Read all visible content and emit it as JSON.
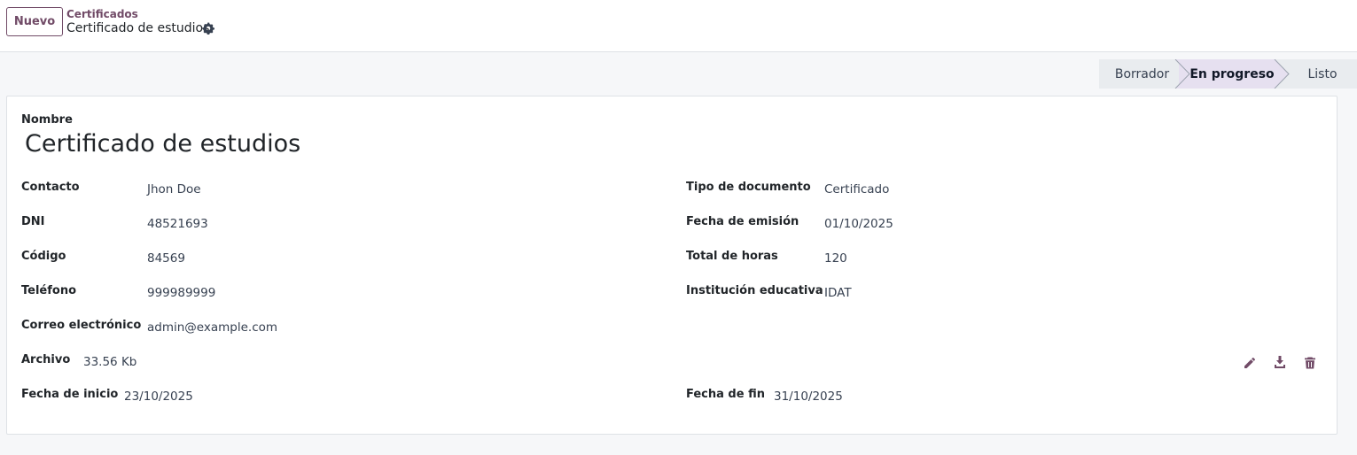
{
  "header": {
    "new_button": "Nuevo",
    "breadcrumb_parent": "Certificados",
    "breadcrumb_current": "Certificado de estudios"
  },
  "status": {
    "stages": [
      "Borrador",
      "En progreso",
      "Listo"
    ],
    "active": "En progreso"
  },
  "form": {
    "name_label": "Nombre",
    "name_value": "Certificado de estudios",
    "left": [
      {
        "label": "Contacto",
        "value": "Jhon Doe"
      },
      {
        "label": "DNI",
        "value": "48521693"
      },
      {
        "label": "Código",
        "value": "84569"
      },
      {
        "label": "Teléfono",
        "value": "999989999"
      },
      {
        "label": "Correo electrónico",
        "value": "admin@example.com"
      }
    ],
    "right": [
      {
        "label": "Tipo de documento",
        "value": "Certificado"
      },
      {
        "label": "Fecha de emisión",
        "value": "01/10/2025"
      },
      {
        "label": "Total de horas",
        "value": "120"
      },
      {
        "label": "Institución educativa",
        "value": "IDAT"
      }
    ],
    "file": {
      "label": "Archivo",
      "value": "33.56 Kb"
    },
    "start": {
      "label": "Fecha de inicio",
      "value": "23/10/2025"
    },
    "end": {
      "label": "Fecha de fin",
      "value": "31/10/2025"
    }
  },
  "icons": {
    "settings": "gear-icon",
    "edit": "pencil-icon",
    "download": "download-icon",
    "delete": "trash-icon"
  },
  "colors": {
    "accent": "#714b67",
    "status_active": "#e6e0f0",
    "status_inactive": "#e9ecef"
  }
}
